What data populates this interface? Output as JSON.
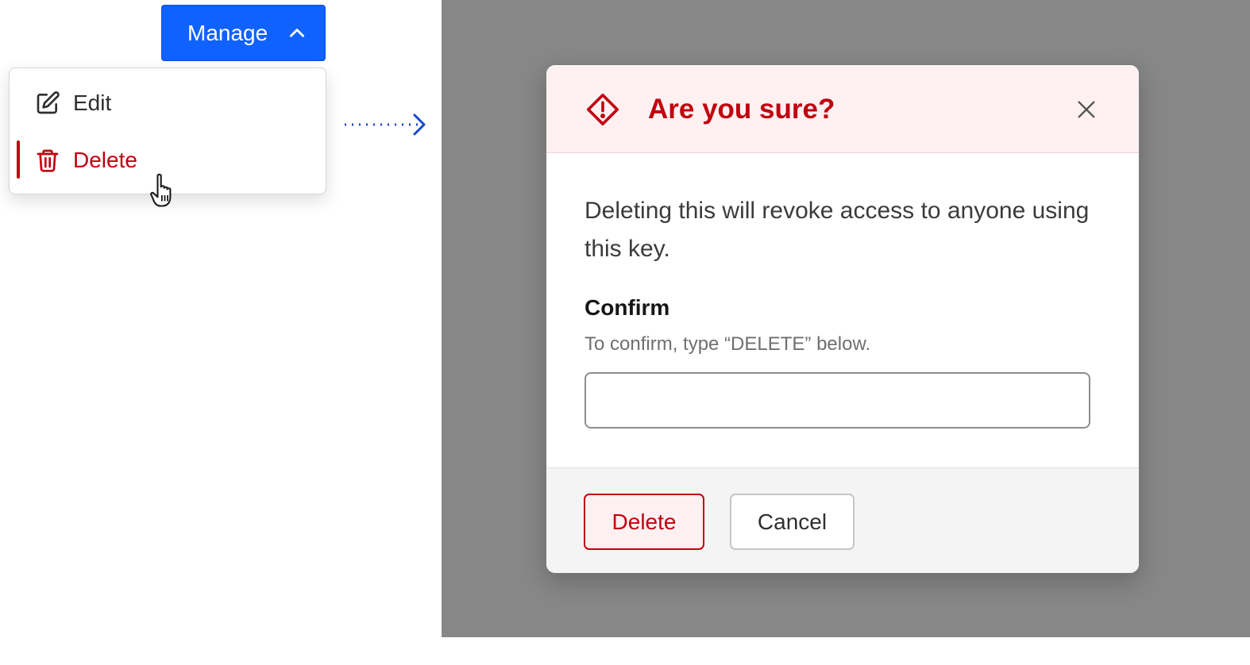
{
  "manage_menu": {
    "button_label": "Manage",
    "chevron_icon": "chevron-up-icon",
    "items": [
      {
        "label": "Edit",
        "icon": "pencil-square-icon",
        "color": "#2f2f2f"
      },
      {
        "label": "Delete",
        "icon": "trash-icon",
        "color": "#c1000f",
        "active": true
      }
    ],
    "accent_color": "#0f62fe"
  },
  "flow_arrow_icon": "dotted-arrow-right-icon",
  "cursor_icon": "pointer-hand-icon",
  "modal": {
    "title": "Are you sure?",
    "warning_icon": "warning-diamond-icon",
    "close_icon": "close-icon",
    "message": "Deleting this will revoke access to anyone using this key.",
    "confirm_field": {
      "label": "Confirm",
      "helper": "To confirm, type “DELETE” below.",
      "value": "",
      "placeholder": ""
    },
    "buttons": {
      "delete": "Delete",
      "cancel": "Cancel"
    },
    "danger_color": "#c1000f",
    "overlay_color": "#878787"
  }
}
